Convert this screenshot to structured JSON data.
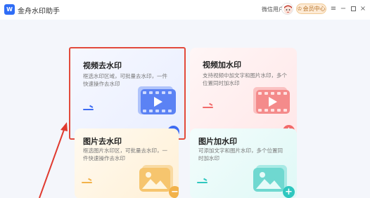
{
  "app": {
    "logo_text": "W",
    "title": "金舟水印助手",
    "user_name": "微信用户",
    "member_label": "会员中心",
    "member_icon": "crown-icon",
    "window_controls": [
      "menu-icon",
      "minimize-icon",
      "maximize-icon",
      "close-icon"
    ]
  },
  "cards": {
    "video_remove": {
      "title": "视频去水印",
      "desc": "框选水印区域，可批量去水印，一件快速操作去水印",
      "accent": "#3d6bf2",
      "badge": "−"
    },
    "video_add": {
      "title": "视频加水印",
      "desc": "支持视频中加文字和图片水印，多个位置同时加水印",
      "accent": "#f26a6a",
      "badge": "+"
    },
    "image_remove": {
      "title": "图片去水印",
      "desc": "框选图片水印区，可批量去水印，一件快速操作去水印",
      "accent": "#f2b24a",
      "badge": "−"
    },
    "image_add": {
      "title": "图片加水印",
      "desc": "可添加文字和图片水印，多个位置同时加水印",
      "accent": "#2fc7bf",
      "badge": "+"
    }
  },
  "colors": {
    "highlight_border": "#e24a3b",
    "annotation_arrow": "#e03a2f"
  }
}
